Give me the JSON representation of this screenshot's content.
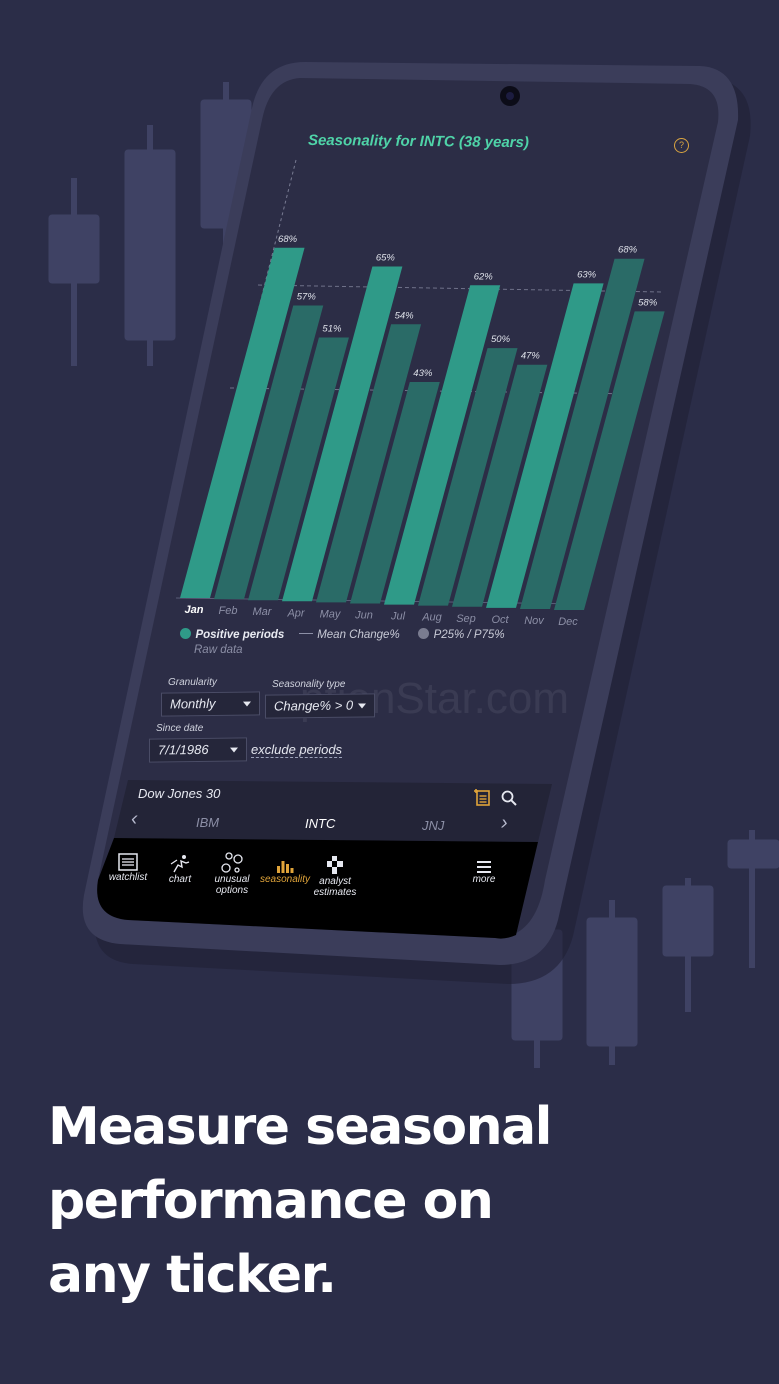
{
  "chart_title": "Seasonality for INTC (38 years)",
  "help_icon": "question-circle-icon",
  "chart_data": {
    "type": "bar",
    "title": "Seasonality for INTC (38 years)",
    "categories": [
      "Jan",
      "Feb",
      "Mar",
      "Apr",
      "May",
      "Jun",
      "Jul",
      "Aug",
      "Sep",
      "Oct",
      "Nov",
      "Dec"
    ],
    "values": [
      68,
      57,
      51,
      65,
      54,
      43,
      62,
      50,
      47,
      63,
      68,
      58
    ],
    "labels": [
      "68%",
      "57%",
      "51%",
      "65%",
      "54%",
      "43%",
      "62%",
      "50%",
      "47%",
      "63%",
      "68%",
      "58%"
    ],
    "ylim": [
      0,
      75
    ],
    "reference_lines": [
      75,
      50
    ],
    "colors": {
      "light": "#2f9a88",
      "dark": "#2a6b67"
    }
  },
  "legend": {
    "positive": "Positive periods",
    "mean": "Mean Change%",
    "pctl": "P25% / P75%",
    "raw": "Raw data"
  },
  "controls": {
    "granularity_label": "Granularity",
    "granularity_value": "Monthly",
    "seasonality_label": "Seasonality type",
    "seasonality_value": "Change% > 0",
    "since_label": "Since date",
    "since_value": "7/1/1986",
    "exclude_link": "exclude periods"
  },
  "watermark": "ptionStar.com",
  "watchlist_bar": {
    "name": "Dow Jones 30",
    "prev": "‹",
    "next": "›",
    "tickers": [
      "IBM",
      "INTC",
      "JNJ"
    ],
    "active_ticker": "INTC"
  },
  "nav": {
    "items": [
      {
        "label": "watchlist",
        "icon": "list-icon"
      },
      {
        "label": "chart",
        "icon": "chart-runner-icon"
      },
      {
        "label": "unusual options",
        "icon": "bubbles-icon"
      },
      {
        "label": "seasonality",
        "icon": "bar-chart-icon"
      },
      {
        "label": "analyst estimates",
        "icon": "checker-flag-icon"
      },
      {
        "label": "more",
        "icon": "hamburger-icon"
      }
    ],
    "active": "seasonality"
  },
  "headline": [
    "Measure seasonal",
    "performance on",
    "any ticker."
  ],
  "accent": "#e0a43a"
}
